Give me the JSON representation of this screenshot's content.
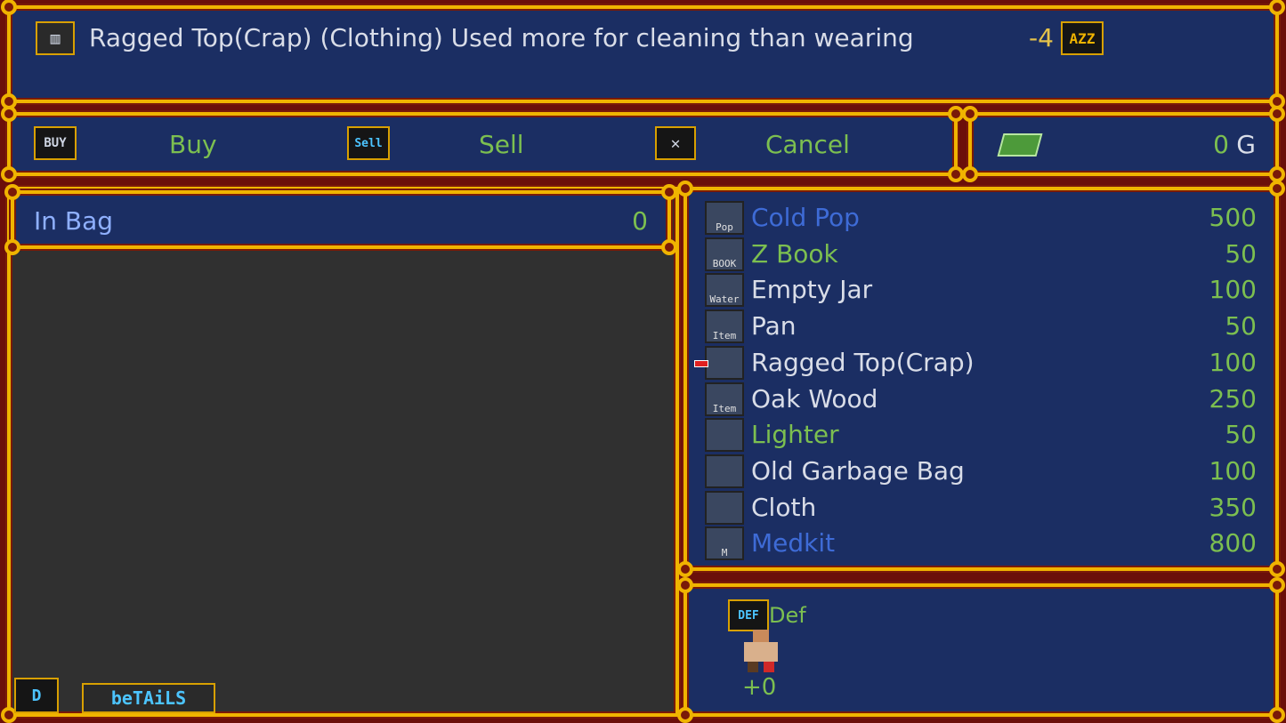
{
  "description_bar": {
    "icon": "shirt-icon",
    "text": "Ragged Top(Crap) (Clothing) Used more for cleaning than wearing",
    "stat_value": "-4",
    "stat_icon": "armor-stat-icon",
    "stat_icon_text": "AZZ"
  },
  "actions": {
    "buy_icon_text": "BUY",
    "buy_label": "Buy",
    "sell_icon_text": "Sell",
    "sell_label": "Sell",
    "cancel_label": "Cancel"
  },
  "money": {
    "icon": "cash-icon",
    "value": "0",
    "unit": "G"
  },
  "bag": {
    "label": "In Bag",
    "count": "0"
  },
  "shop_items": [
    {
      "name": "Cold Pop",
      "price": "500",
      "name_color": "#3e6bd6",
      "icon": "soda-can-icon",
      "icon_text": "Pop"
    },
    {
      "name": "Z Book",
      "price": "50",
      "name_color": "#7cbf50",
      "icon": "book-icon",
      "icon_text": "BOOK"
    },
    {
      "name": "Empty Jar",
      "price": "100",
      "name_color": "#d9dde8",
      "icon": "jar-icon",
      "icon_text": "Water"
    },
    {
      "name": "Pan",
      "price": "50",
      "name_color": "#d9dde8",
      "icon": "pan-icon",
      "icon_text": "Item"
    },
    {
      "name": "Ragged Top(Crap)",
      "price": "100",
      "name_color": "#d9dde8",
      "icon": "shirt-icon",
      "icon_text": ""
    },
    {
      "name": "Oak Wood",
      "price": "250",
      "name_color": "#d9dde8",
      "icon": "wood-icon",
      "icon_text": "Item"
    },
    {
      "name": "Lighter",
      "price": "50",
      "name_color": "#7cbf50",
      "icon": "lighter-icon",
      "icon_text": ""
    },
    {
      "name": "Old Garbage Bag",
      "price": "100",
      "name_color": "#d9dde8",
      "icon": "garbage-bag-icon",
      "icon_text": ""
    },
    {
      "name": "Cloth",
      "price": "350",
      "name_color": "#d9dde8",
      "icon": "cloth-icon",
      "icon_text": ""
    },
    {
      "name": "Medkit",
      "price": "800",
      "name_color": "#3e6bd6",
      "icon": "medkit-icon",
      "icon_text": "M"
    }
  ],
  "stats": {
    "label": "Def",
    "icon_text": "DEF",
    "change": "+0"
  },
  "bottom": {
    "details_label": "beTAiLS",
    "d_icon_text": "D"
  },
  "colors": {
    "panel_blue": "#1b2e63",
    "gold_border": "#f0b400",
    "dark_panel": "#303030",
    "text_green": "#7cbf50",
    "text_white": "#d9dde8",
    "text_blue": "#3e6bd6"
  }
}
